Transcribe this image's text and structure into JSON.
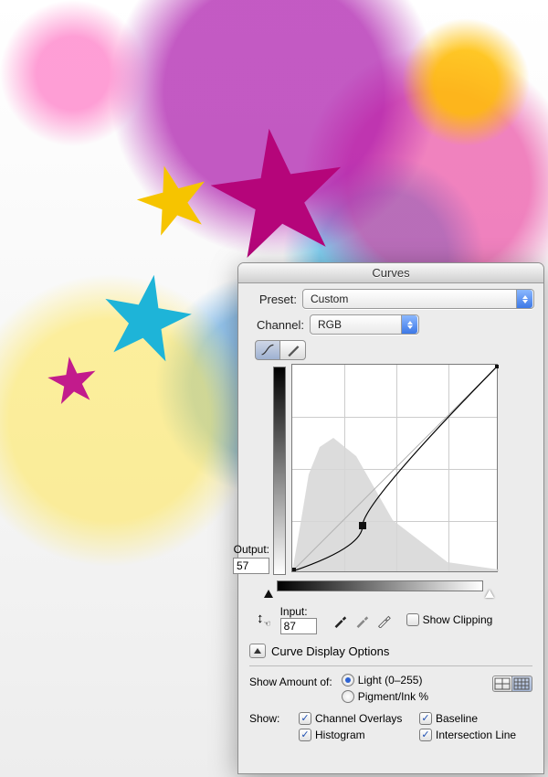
{
  "dialog": {
    "title": "Curves",
    "preset_label": "Preset:",
    "preset_value": "Custom",
    "channel_label": "Channel:",
    "channel_value": "RGB",
    "output_label": "Output:",
    "output_value": "57",
    "input_label": "Input:",
    "input_value": "87",
    "show_clipping_label": "Show Clipping",
    "show_clipping_checked": false,
    "disclosure_label": "Curve Display Options",
    "show_amount_label": "Show Amount of:",
    "amount_light_label": "Light  (0–255)",
    "amount_pigment_label": "Pigment/Ink %",
    "amount_selected": "light",
    "show_label": "Show:",
    "show_channel_overlays": "Channel Overlays",
    "show_histogram": "Histogram",
    "show_baseline": "Baseline",
    "show_intersection": "Intersection Line"
  },
  "chart_data": {
    "type": "line",
    "title": "RGB curve",
    "xlabel": "Input",
    "ylabel": "Output",
    "xlim": [
      0,
      255
    ],
    "ylim": [
      0,
      255
    ],
    "series": [
      {
        "name": "baseline",
        "x": [
          0,
          255
        ],
        "y": [
          0,
          255
        ]
      },
      {
        "name": "curve",
        "x": [
          0,
          87,
          255
        ],
        "y": [
          0,
          57,
          255
        ]
      }
    ],
    "control_point": {
      "input": 87,
      "output": 57
    },
    "histogram_visible": true
  }
}
